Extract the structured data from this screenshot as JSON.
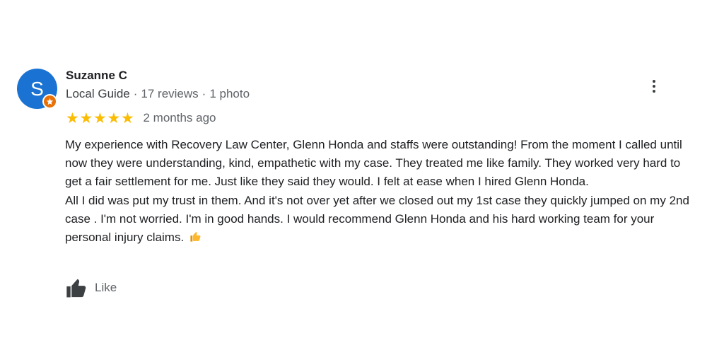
{
  "reviewer": {
    "initial": "S",
    "name": "Suzanne C",
    "badge_icon": "local-guide-star-icon",
    "guide_label": "Local Guide",
    "separator": "·",
    "review_count": "17 reviews",
    "photo_count": "1 photo"
  },
  "rating": {
    "stars": 5,
    "time_ago": "2 months ago"
  },
  "review": {
    "paragraphs": [
      "My experience with Recovery Law Center, Glenn Honda and staffs were outstanding! From the moment I called until now they were understanding,  kind, empathetic with my case. They treated me like family. They worked very hard to get a fair settlement for me. Just like they said they would. I felt at ease when I hired Glenn Honda.",
      "All I did was put my trust in them. And it's not over yet after we closed out my 1st case they quickly jumped on my 2nd case . I'm not worried. I'm in good hands. I would recommend Glenn Honda and his hard working team for your personal injury claims."
    ],
    "emoji_icon": "thumbs-up-emoji-icon"
  },
  "actions": {
    "like_label": "Like",
    "like_icon": "thumbs-up-icon",
    "menu_icon": "more-vertical-icon"
  },
  "colors": {
    "avatar": "#1a73d3",
    "badge": "#e8710a",
    "star": "#fbbc04",
    "secondary_text": "#5f6368"
  }
}
